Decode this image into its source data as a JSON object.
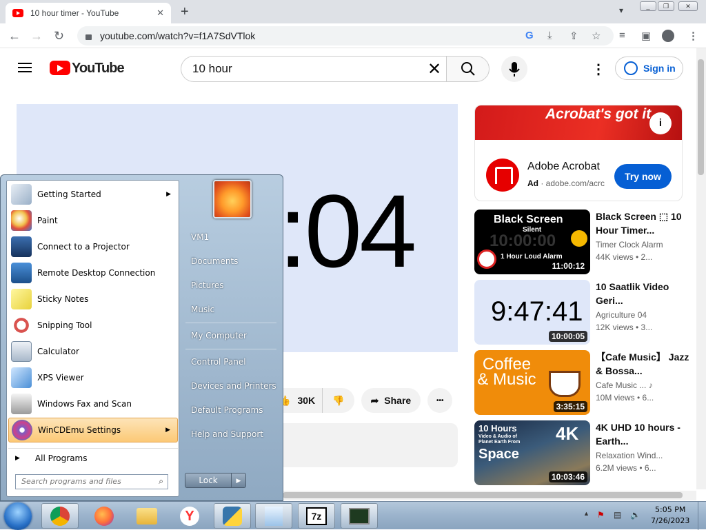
{
  "browser": {
    "tab_title": "10 hour timer - YouTube",
    "url": "youtube.com/watch?v=f1A7SdVTlok",
    "tab_close": "✕",
    "new_tab": "+",
    "back": "←",
    "forward": "→",
    "reload": "↻"
  },
  "youtube": {
    "logo_text": "YouTube",
    "search_value": "10 hour",
    "clear": "✕",
    "sign_in": "Sign in",
    "video_time_display": ":04",
    "like_count": "30K",
    "share_label": "Share",
    "more": "•••"
  },
  "ad": {
    "banner_text": "Acrobat's got it.",
    "info": "i",
    "title": "Adobe Acrobat",
    "ad_badge": "Ad",
    "domain": "adobe.com/acrc",
    "cta": "Try now"
  },
  "recommendations": [
    {
      "thumb_title": "Black Screen",
      "thumb_sub": "Silent",
      "thumb_time": "10:00:00",
      "thumb_footer": "1 Hour Loud Alarm",
      "duration": "11:00:12",
      "title": "Black Screen ⬚ 10 Hour Timer...",
      "channel": "Timer Clock Alarm",
      "meta": "44K views • 2..."
    },
    {
      "thumb_time": "9:47:41",
      "duration": "10:00:05",
      "title": "10 Saatlik Video Geri...",
      "channel": "Agriculture 04",
      "meta": "12K views • 3..."
    },
    {
      "thumb_title": "Coffee & Music",
      "duration": "3:35:15",
      "title": "【Cafe Music】 Jazz & Bossa...",
      "channel": "Cafe Music ... ♪",
      "meta": "10M views • 6..."
    },
    {
      "thumb_title": "10 Hours",
      "thumb_sub": "Video & Audio of Planet Earth From",
      "thumb_footer": "Space",
      "thumb_badge": "4K",
      "duration": "10:03:46",
      "title": "4K UHD 10 hours - Earth...",
      "channel": "Relaxation Wind...",
      "meta": "6.2M views • 6..."
    }
  ],
  "start_menu": {
    "programs": [
      {
        "label": "Getting Started",
        "icon": "getting-started-icon",
        "arrow": "▶"
      },
      {
        "label": "Paint",
        "icon": "paint-icon"
      },
      {
        "label": "Connect to a Projector",
        "icon": "projector-icon"
      },
      {
        "label": "Remote Desktop Connection",
        "icon": "remote-desktop-icon"
      },
      {
        "label": "Sticky Notes",
        "icon": "sticky-notes-icon"
      },
      {
        "label": "Snipping Tool",
        "icon": "snipping-tool-icon"
      },
      {
        "label": "Calculator",
        "icon": "calculator-icon"
      },
      {
        "label": "XPS Viewer",
        "icon": "xps-viewer-icon"
      },
      {
        "label": "Windows Fax and Scan",
        "icon": "fax-scan-icon"
      },
      {
        "label": "WinCDEmu Settings",
        "icon": "wincdemu-icon",
        "arrow": "▶"
      }
    ],
    "all_programs": "All Programs",
    "all_programs_arrow": "▶",
    "search_placeholder": "Search programs and files",
    "right_links": [
      "VM1",
      "Documents",
      "Pictures",
      "Music",
      "My Computer",
      "Control Panel",
      "Devices and Printers",
      "Default Programs",
      "Help and Support"
    ],
    "lock": "Lock",
    "lock_arrow": "▶"
  },
  "taskbar": {
    "time": "5:05 PM",
    "date": "7/26/2023",
    "apps": [
      "chrome-icon",
      "firefox-icon",
      "explorer-icon",
      "yandex-icon",
      "python-icon",
      "notepad-icon",
      "7zip-icon",
      "taskmgr-icon"
    ]
  }
}
